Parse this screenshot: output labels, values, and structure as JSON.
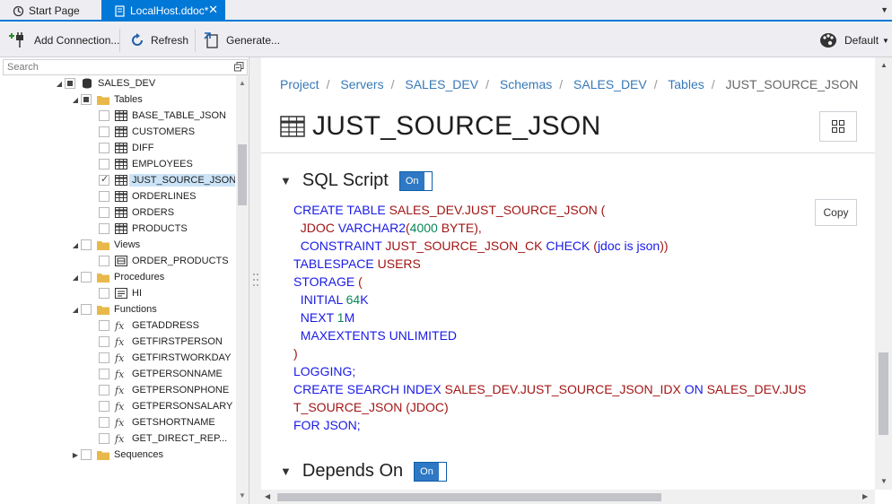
{
  "tabs": [
    {
      "label": "Start Page",
      "icon": "start-page-icon"
    },
    {
      "label": "LocalHost.ddoc*",
      "icon": "document-icon",
      "active": true
    }
  ],
  "toolbar": {
    "add_connection": "Add Connection...",
    "refresh": "Refresh",
    "generate": "Generate...",
    "theme": "Default"
  },
  "search": {
    "placeholder": "Search"
  },
  "tree": {
    "root": "SALES_DEV",
    "tables_label": "Tables",
    "tables": [
      "BASE_TABLE_JSON",
      "CUSTOMERS",
      "DIFF",
      "EMPLOYEES",
      "JUST_SOURCE_JSON",
      "ORDERLINES",
      "ORDERS",
      "PRODUCTS"
    ],
    "views_label": "Views",
    "views": [
      "ORDER_PRODUCTS"
    ],
    "procedures_label": "Procedures",
    "procedures": [
      "HI"
    ],
    "functions_label": "Functions",
    "functions": [
      "GETADDRESS",
      "GETFIRSTPERSON",
      "GETFIRSTWORKDAY",
      "GETPERSONNAME",
      "GETPERSONPHONE",
      "GETPERSONSALARY",
      "GETSHORTNAME",
      "GET_DIRECT_REP..."
    ],
    "sequences_label": "Sequences"
  },
  "breadcrumb": [
    "Project",
    "Servers",
    "SALES_DEV",
    "Schemas",
    "SALES_DEV",
    "Tables",
    "JUST_SOURCE_JSON"
  ],
  "page_title": "JUST_SOURCE_JSON",
  "sql_section": {
    "title": "SQL Script",
    "toggle": "On",
    "copy": "Copy"
  },
  "depends_section": {
    "title": "Depends On",
    "toggle": "On"
  },
  "sql_lines": [
    [
      [
        "kw",
        "CREATE TABLE "
      ],
      [
        "id",
        "SALES_DEV.JUST_SOURCE_JSON ("
      ]
    ],
    [
      [
        "id",
        "  JDOC "
      ],
      [
        "kw",
        "VARCHAR2"
      ],
      [
        "id",
        "("
      ],
      [
        "num",
        "4000"
      ],
      [
        "id",
        " BYTE),"
      ]
    ],
    [
      [
        "kw",
        "  CONSTRAINT "
      ],
      [
        "id",
        "JUST_SOURCE_JSON_CK "
      ],
      [
        "kw",
        "CHECK "
      ],
      [
        "id",
        "("
      ],
      [
        "kw",
        "jdoc is json"
      ],
      [
        "id",
        "))"
      ]
    ],
    [
      [
        "kw",
        "TABLESPACE "
      ],
      [
        "id",
        "USERS"
      ]
    ],
    [
      [
        "kw",
        "STORAGE "
      ],
      [
        "id",
        "("
      ]
    ],
    [
      [
        "kw",
        "  INITIAL "
      ],
      [
        "num",
        "64"
      ],
      [
        "kw",
        "K"
      ]
    ],
    [
      [
        "kw",
        "  NEXT "
      ],
      [
        "num",
        "1"
      ],
      [
        "kw",
        "M"
      ]
    ],
    [
      [
        "kw",
        "  MAXEXTENTS UNLIMITED"
      ]
    ],
    [
      [
        "id",
        ")"
      ]
    ],
    [
      [
        "kw",
        "LOGGING;"
      ]
    ],
    [
      [
        "kw",
        "CREATE SEARCH INDEX "
      ],
      [
        "id",
        "SALES_DEV.JUST_SOURCE_JSON_IDX "
      ],
      [
        "kw",
        "ON "
      ],
      [
        "id",
        "SALES_DEV.JUS"
      ]
    ],
    [
      [
        "id",
        "T_SOURCE_JSON (JDOC)"
      ]
    ],
    [
      [
        "kw",
        "FOR JSON;"
      ]
    ]
  ],
  "colors": {
    "accent": "#0078d7",
    "keyword": "#1a1ae6",
    "identifier": "#a31515",
    "number": "#098658",
    "link": "#3779b7"
  }
}
